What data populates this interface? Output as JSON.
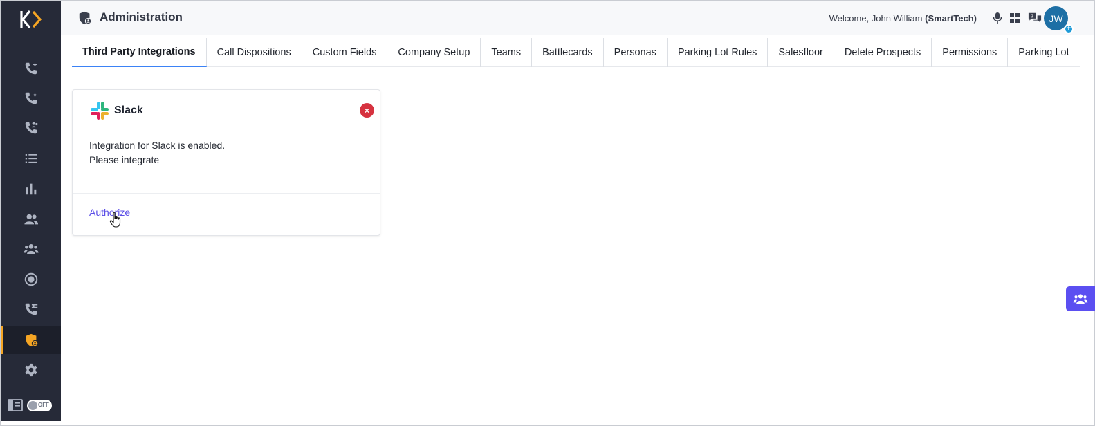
{
  "app": {
    "logo_icon": "kixie-logo-icon",
    "accent_color": "#f5a524",
    "sidebar_color": "#262a38"
  },
  "sidebar": {
    "items": [
      {
        "name": "powerdialer-icon"
      },
      {
        "name": "ai-dialer-icon"
      },
      {
        "name": "team-calls-icon"
      },
      {
        "name": "lists-icon"
      },
      {
        "name": "reports-icon"
      },
      {
        "name": "contacts-icon"
      },
      {
        "name": "teams-icon"
      },
      {
        "name": "record-icon"
      },
      {
        "name": "call-routing-icon"
      },
      {
        "name": "admin-shield-icon",
        "active": true
      },
      {
        "name": "settings-gear-icon"
      }
    ],
    "toggle_label": "OFF"
  },
  "header": {
    "title": "Administration",
    "welcome_prefix": "Welcome, John William",
    "company": "(SmartTech)",
    "avatar_initials": "JW",
    "avatar_badge": "+"
  },
  "tabs": [
    {
      "label": "Third Party Integrations",
      "active": true
    },
    {
      "label": "Call Dispositions"
    },
    {
      "label": "Custom Fields"
    },
    {
      "label": "Company Setup"
    },
    {
      "label": "Teams"
    },
    {
      "label": "Battlecards"
    },
    {
      "label": "Personas"
    },
    {
      "label": "Parking Lot Rules"
    },
    {
      "label": "Salesfloor"
    },
    {
      "label": "Delete Prospects"
    },
    {
      "label": "Permissions"
    },
    {
      "label": "Parking Lot"
    }
  ],
  "card": {
    "title": "Slack",
    "close_glyph": "×",
    "line1": "Integration for Slack is enabled.",
    "line2": "Please integrate",
    "action_label": "Authorize",
    "link_color": "#5a4de6"
  }
}
